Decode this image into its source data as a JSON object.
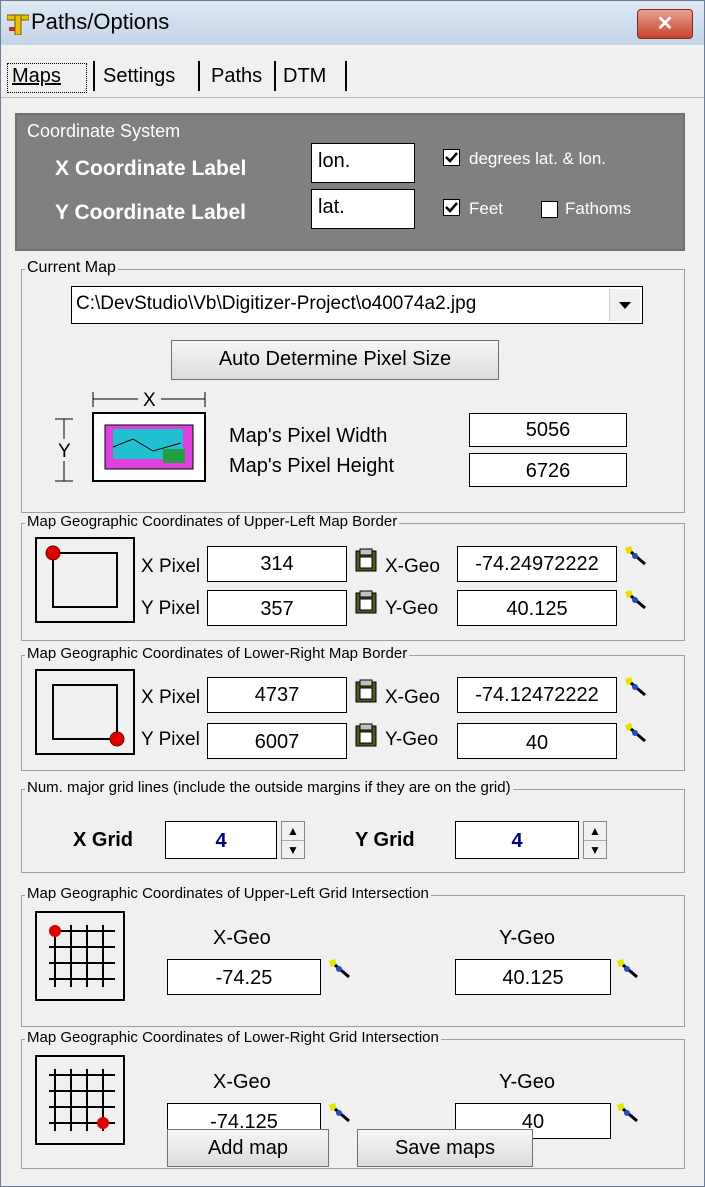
{
  "window": {
    "title": "Paths/Options",
    "close_label": "✕"
  },
  "tabs": [
    {
      "label": "Maps"
    },
    {
      "label": "Settings"
    },
    {
      "label": "Paths"
    },
    {
      "label": "DTM"
    }
  ],
  "coordinate_system": {
    "title": "Coordinate System",
    "x_label": "X Coordinate Label",
    "x_value": "lon.",
    "y_label": "Y Coordinate Label",
    "y_value": "lat.",
    "degrees_label": "degrees lat. & lon.",
    "degrees_checked": true,
    "feet_label": "Feet",
    "feet_checked": true,
    "fathoms_label": "Fathoms",
    "fathoms_checked": false
  },
  "current_map": {
    "title": "Current Map",
    "path": "C:\\DevStudio\\Vb\\Digitizer-Project\\o40074a2.jpg",
    "auto_button": "Auto Determine Pixel Size",
    "x_symbol": "X",
    "y_symbol": "Y",
    "width_label": "Map's Pixel Width",
    "width_value": "5056",
    "height_label": "Map's Pixel Height",
    "height_value": "6726"
  },
  "upper_left_border": {
    "title": "Map Geographic Coordinates of Upper-Left Map Border",
    "x_pixel_label": "X Pixel",
    "x_pixel": "314",
    "y_pixel_label": "Y Pixel",
    "y_pixel": "357",
    "x_geo_label": "X-Geo",
    "x_geo": "-74.24972222",
    "y_geo_label": "Y-Geo",
    "y_geo": "40.125"
  },
  "lower_right_border": {
    "title": "Map Geographic Coordinates of Lower-Right Map Border",
    "x_pixel_label": "X Pixel",
    "x_pixel": "4737",
    "y_pixel_label": "Y Pixel",
    "y_pixel": "6007",
    "x_geo_label": "X-Geo",
    "x_geo": "-74.12472222",
    "y_geo_label": "Y-Geo",
    "y_geo": "40"
  },
  "grid_lines": {
    "title": "Num. major grid lines (include the outside margins if they are on the grid)",
    "x_label": "X Grid",
    "x_value": "4",
    "y_label": "Y Grid",
    "y_value": "4"
  },
  "upper_left_grid": {
    "title": "Map Geographic Coordinates of Upper-Left Grid Intersection",
    "x_geo_label": "X-Geo",
    "x_geo": "-74.25",
    "y_geo_label": "Y-Geo",
    "y_geo": "40.125"
  },
  "lower_right_grid": {
    "title": "Map Geographic Coordinates of Lower-Right Grid Intersection",
    "x_geo_label": "X-Geo",
    "x_geo": "-74.125",
    "y_geo_label": "Y-Geo",
    "y_geo": "40"
  },
  "buttons": {
    "add_map": "Add map",
    "save_maps": "Save maps"
  },
  "icons": {
    "app": "paths-app-icon",
    "picker": "map-pick-icon",
    "clipboard": "clipboard-icon"
  }
}
